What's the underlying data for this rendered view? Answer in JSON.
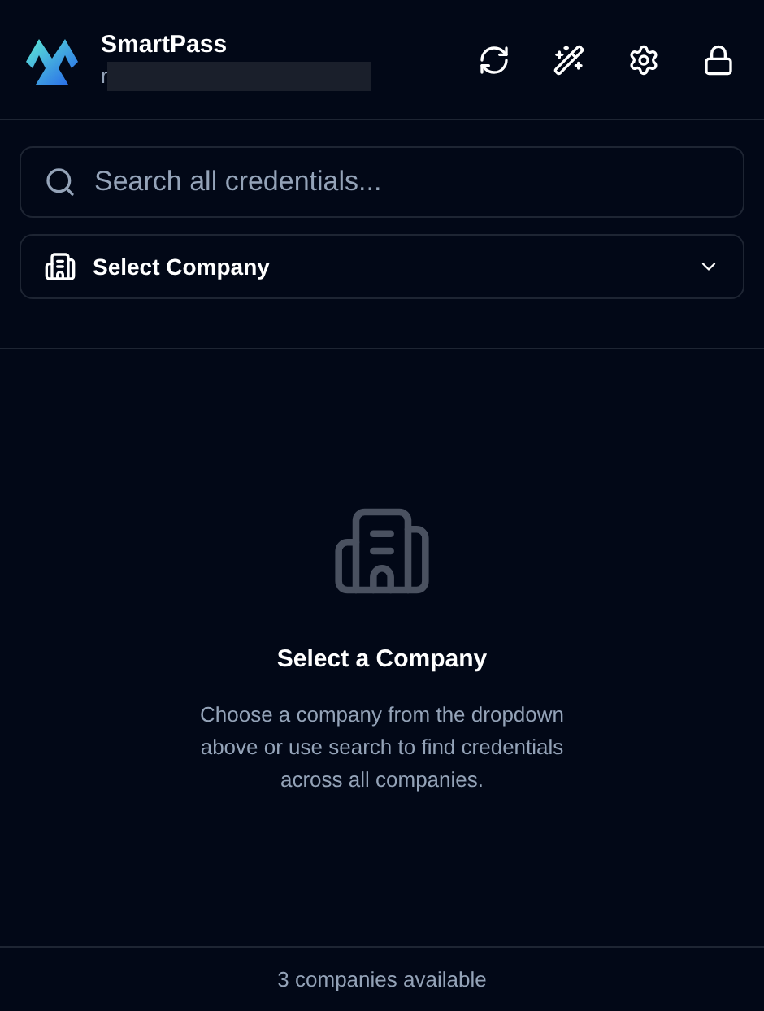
{
  "header": {
    "title": "SmartPass",
    "subtitle": "r"
  },
  "search": {
    "placeholder": "Search all credentials..."
  },
  "company_select": {
    "label": "Select Company"
  },
  "empty_state": {
    "title": "Select a Company",
    "message": "Choose a company from the dropdown above or use search to find credentials across all companies."
  },
  "status_bar": {
    "text": "3 companies available"
  }
}
